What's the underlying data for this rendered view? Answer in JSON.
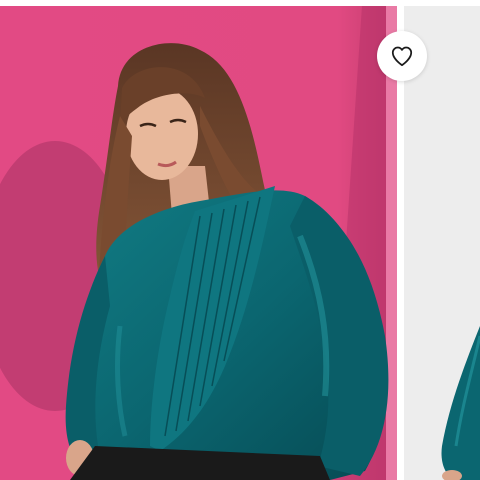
{
  "gallery": {
    "slides": [
      {
        "name": "product-photo-teal-satin-ruffle-blouse"
      },
      {
        "name": "product-photo-next-partial"
      }
    ],
    "wishlist": {
      "icon": "heart-outline-icon"
    },
    "colors": {
      "backdrop": "#e0457f",
      "blouse": "#0d6b74",
      "next_backdrop": "#ededed"
    }
  }
}
